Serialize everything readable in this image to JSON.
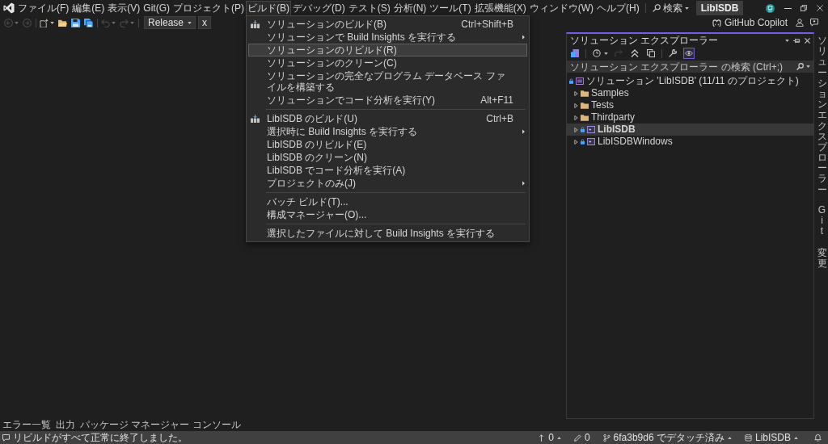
{
  "title_bar": {
    "menu": [
      {
        "label": "ファイル(F)",
        "selected": false
      },
      {
        "label": "編集(E)",
        "selected": false
      },
      {
        "label": "表示(V)",
        "selected": false
      },
      {
        "label": "Git(G)",
        "selected": false
      },
      {
        "label": "プロジェクト(P)",
        "selected": false
      },
      {
        "label": "ビルド(B)",
        "selected": true
      },
      {
        "label": "デバッグ(D)",
        "selected": false
      },
      {
        "label": "テスト(S)",
        "selected": false
      },
      {
        "label": "分析(N)",
        "selected": false
      },
      {
        "label": "ツール(T)",
        "selected": false
      },
      {
        "label": "拡張機能(X)",
        "selected": false
      },
      {
        "label": "ウィンドウ(W)",
        "selected": false
      },
      {
        "label": "ヘルプ(H)",
        "selected": false
      }
    ],
    "search": {
      "label": "検索"
    },
    "solution_name": "LibISDB"
  },
  "toolbar": {
    "groups": [
      {
        "buttons": [
          {
            "kind": "back",
            "disabled": true
          },
          {
            "kind": "forward",
            "disabled": true
          }
        ]
      },
      {
        "buttons": [
          {
            "kind": "new-item",
            "disabled": false
          },
          {
            "kind": "open",
            "disabled": false
          },
          {
            "kind": "save",
            "disabled": false
          },
          {
            "kind": "save-all",
            "disabled": false
          }
        ]
      },
      {
        "buttons": [
          {
            "kind": "undo",
            "disabled": true
          },
          {
            "kind": "redo",
            "disabled": true
          }
        ]
      }
    ],
    "configuration": "Release",
    "platform": "x",
    "copilot": "GitHub Copilot"
  },
  "build_menu": {
    "groups": [
      {
        "items": [
          {
            "label": "ソリューションのビルド(B)",
            "kind": "build",
            "shortcut": "Ctrl+Shift+B",
            "submenu": false,
            "selected": false
          },
          {
            "label": "ソリューションで Build Insights を実行する",
            "kind": "plain",
            "submenu": true,
            "selected": false
          },
          {
            "label": "ソリューションのリビルド(R)",
            "kind": "plain",
            "submenu": false,
            "selected": true
          },
          {
            "label": "ソリューションのクリーン(C)",
            "kind": "plain",
            "submenu": false,
            "selected": false
          },
          {
            "label": "ソリューションの完全なプログラム データベース ファイルを構築する",
            "kind": "plain",
            "submenu": false,
            "selected": false
          },
          {
            "label": "ソリューションでコード分析を実行(Y)",
            "kind": "plain",
            "shortcut": "Alt+F11",
            "submenu": false,
            "selected": false
          }
        ]
      },
      {
        "items": [
          {
            "label": "LibISDB のビルド(U)",
            "kind": "build",
            "shortcut": "Ctrl+B",
            "submenu": false,
            "selected": false
          },
          {
            "label": "選択時に Build Insights を実行する",
            "kind": "plain",
            "submenu": true,
            "selected": false
          },
          {
            "label": "LibISDB のリビルド(E)",
            "kind": "plain",
            "submenu": false,
            "selected": false
          },
          {
            "label": "LibISDB のクリーン(N)",
            "kind": "plain",
            "submenu": false,
            "selected": false
          },
          {
            "label": "LibISDB でコード分析を実行(A)",
            "kind": "plain",
            "submenu": false,
            "selected": false
          },
          {
            "label": "プロジェクトのみ(J)",
            "kind": "plain",
            "submenu": true,
            "selected": false
          }
        ]
      },
      {
        "items": [
          {
            "label": "バッチ ビルド(T)...",
            "kind": "plain",
            "submenu": false,
            "selected": false
          },
          {
            "label": "構成マネージャー(O)...",
            "kind": "plain",
            "submenu": false,
            "selected": false
          }
        ]
      },
      {
        "items": [
          {
            "label": "選択したファイルに対して Build Insights を実行する",
            "kind": "plain",
            "submenu": false,
            "selected": false
          }
        ]
      }
    ]
  },
  "solution_explorer": {
    "title": "ソリューション エクスプローラー",
    "active": true,
    "toolbar": {
      "groups": [
        {
          "tools": [
            {
              "kind": "views",
              "on": false,
              "disabled": false
            }
          ]
        },
        {
          "tools": [
            {
              "kind": "pending",
              "on": false,
              "disabled": false
            },
            {
              "kind": "sync",
              "on": false,
              "disabled": true
            },
            {
              "kind": "collapse",
              "on": false,
              "disabled": false
            },
            {
              "kind": "show-all",
              "on": false,
              "disabled": false
            }
          ]
        },
        {
          "tools": [
            {
              "kind": "properties",
              "on": false,
              "disabled": false
            },
            {
              "kind": "preview",
              "on": true,
              "disabled": false
            }
          ]
        }
      ]
    },
    "search": {
      "placeholder": "ソリューション エクスプローラー の検索 (Ctrl+;)"
    },
    "tree": [
      {
        "label": "ソリューション 'LibISDB' (11/11 のプロジェクト)",
        "kind": "solution",
        "locked": true,
        "selected": false,
        "children": [
          {
            "label": "Samples",
            "kind": "folder",
            "locked": false,
            "expanded": false,
            "selected": false
          },
          {
            "label": "Tests",
            "kind": "folder",
            "locked": false,
            "expanded": false,
            "selected": false
          },
          {
            "label": "Thirdparty",
            "kind": "folder",
            "locked": false,
            "expanded": false,
            "selected": false
          },
          {
            "label": "LibISDB",
            "kind": "project",
            "locked": true,
            "expanded": false,
            "selected": true,
            "startup": true
          },
          {
            "label": "LibISDBWindows",
            "kind": "project",
            "locked": true,
            "expanded": false,
            "selected": false,
            "startup": false
          }
        ]
      }
    ]
  },
  "side_tabs": [
    {
      "label": "ソリューションエクスプローラー",
      "selected": false
    },
    {
      "label": "Git 変更",
      "selected": false
    }
  ],
  "bottom_tabs": [
    {
      "label": "エラー一覧",
      "selected": false
    },
    {
      "label": "出力",
      "selected": false
    },
    {
      "label": "パッケージ マネージャー コンソール",
      "selected": false
    }
  ],
  "status_bar": {
    "message": "リビルドがすべて正常に終了しました。",
    "items": [
      {
        "kind": "push",
        "label": "0",
        "caret": true
      },
      {
        "kind": "changes",
        "label": "0",
        "caret": false
      },
      {
        "kind": "branch",
        "label": "6fa3b9d6 でデタッチ済み",
        "caret": true
      },
      {
        "kind": "repo",
        "label": "LibISDB",
        "caret": true
      }
    ]
  }
}
